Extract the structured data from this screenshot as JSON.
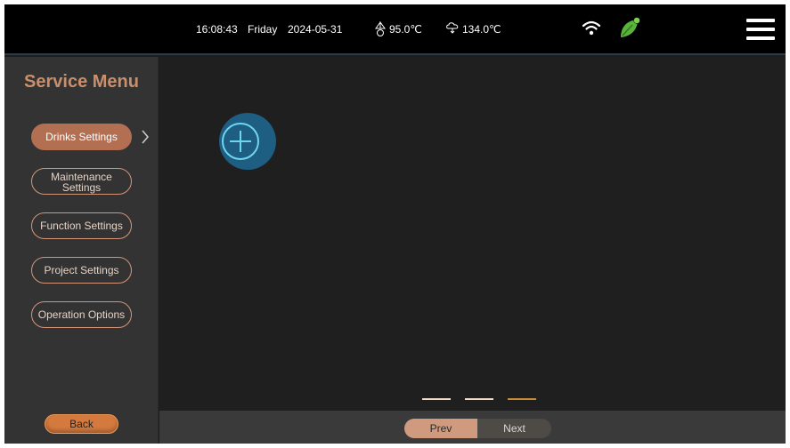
{
  "status_bar": {
    "time": "16:08:43",
    "day": "Friday",
    "date": "2024-05-31",
    "temperature_1": "95.0℃",
    "temperature_2": "134.0℃",
    "icons": [
      "thermometer-icon",
      "steam-icon",
      "wifi-icon",
      "leaf-icon",
      "hamburger-menu-icon"
    ]
  },
  "sidebar": {
    "title": "Service Menu",
    "items": [
      {
        "label": "Drinks Settings",
        "active": true
      },
      {
        "label": "Maintenance Settings",
        "active": false
      },
      {
        "label": "Function Settings",
        "active": false
      },
      {
        "label": "Project Settings",
        "active": false
      },
      {
        "label": "Operation Options",
        "active": false
      }
    ],
    "back_label": "Back"
  },
  "main": {
    "add_icon": "plus-circle-icon",
    "page_indicator": {
      "pages": 3,
      "current": 3
    }
  },
  "pagination": {
    "prev_label": "Prev",
    "next_label": "Next"
  },
  "colors": {
    "accent": "#b36f52",
    "back_button": "#d47a3e",
    "add_button": "#1d5e82",
    "leaf": "#5ab43c"
  }
}
